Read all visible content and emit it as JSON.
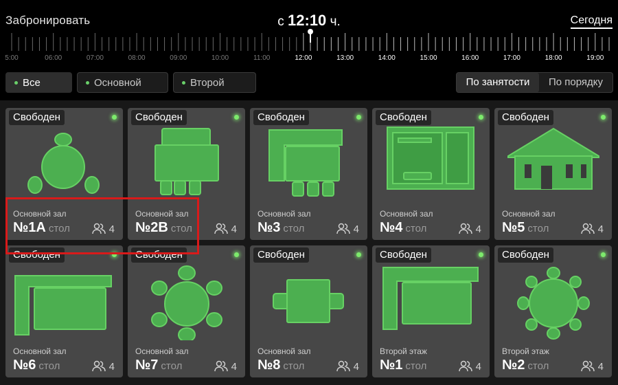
{
  "header": {
    "title": "Забронировать",
    "time_prefix": "с",
    "time_value": "12:10",
    "time_suffix": "ч.",
    "today_label": "Сегодня"
  },
  "timeline": {
    "hours": [
      "5:00",
      "06:00",
      "07:00",
      "08:00",
      "09:00",
      "10:00",
      "11:00",
      "12:00",
      "13:00",
      "14:00",
      "15:00",
      "16:00",
      "17:00",
      "18:00",
      "19:00"
    ],
    "current_index": 7
  },
  "filters": [
    {
      "label": "Все залы",
      "active": true
    },
    {
      "label": "Основной зал",
      "active": false
    },
    {
      "label": "Второй этаж",
      "active": false
    }
  ],
  "sort": {
    "by_occupancy": "По занятости",
    "by_order": "По порядку"
  },
  "colors": {
    "accent_green": "#4caf50",
    "status_dot": "#7dea6c",
    "highlight": "#d91a1a"
  },
  "cards": [
    {
      "status": "Свободен",
      "hall": "Основной зал",
      "number": "№1A",
      "type": "стол",
      "guests": "4",
      "icon": "round-table-3-chairs-icon"
    },
    {
      "status": "Свободен",
      "hall": "Основной зал",
      "number": "№2B",
      "type": "стол",
      "guests": "4",
      "icon": "table-4-chairs-sofa-icon"
    },
    {
      "status": "Свободен",
      "hall": "Основной зал",
      "number": "№3",
      "type": "стол",
      "guests": "4",
      "icon": "corner-sofa-table-icon"
    },
    {
      "status": "Свободен",
      "hall": "Основной зал",
      "number": "№4",
      "type": "стол",
      "guests": "4",
      "icon": "room-plan-icon"
    },
    {
      "status": "Свободен",
      "hall": "Основной зал",
      "number": "№5",
      "type": "стол",
      "guests": "4",
      "icon": "house-icon"
    },
    {
      "status": "Свободен",
      "hall": "Основной зал",
      "number": "№6",
      "type": "стол",
      "guests": "4",
      "icon": "corner-sofa-icon"
    },
    {
      "status": "Свободен",
      "hall": "Основной зал",
      "number": "№7",
      "type": "стол",
      "guests": "4",
      "icon": "round-table-6-chairs-icon"
    },
    {
      "status": "Свободен",
      "hall": "Основной зал",
      "number": "№8",
      "type": "стол",
      "guests": "4",
      "icon": "square-table-2-chairs-icon"
    },
    {
      "status": "Свободен",
      "hall": "Второй этаж",
      "number": "№1",
      "type": "стол",
      "guests": "4",
      "icon": "corner-sofa-icon"
    },
    {
      "status": "Свободен",
      "hall": "Второй этаж",
      "number": "№2",
      "type": "стол",
      "guests": "4",
      "icon": "round-table-8-chairs-icon"
    }
  ]
}
